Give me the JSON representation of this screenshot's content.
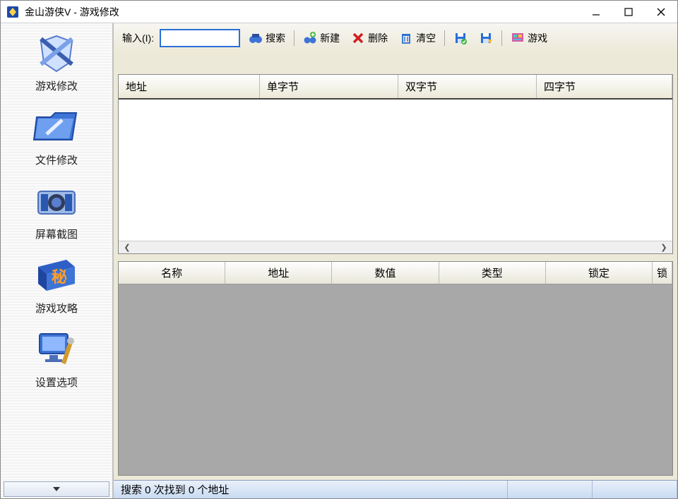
{
  "title": "金山游侠V - 游戏修改",
  "sidebar": {
    "items": [
      {
        "label": "游戏修改"
      },
      {
        "label": "文件修改"
      },
      {
        "label": "屏幕截图"
      },
      {
        "label": "游戏攻略"
      },
      {
        "label": "设置选项"
      }
    ]
  },
  "toolbar": {
    "input_label": "输入(I):",
    "input_value": "",
    "search": "搜索",
    "new": "新建",
    "delete": "删除",
    "clear": "清空",
    "game": "游戏"
  },
  "upper_table": {
    "columns": [
      "地址",
      "单字节",
      "双字节",
      "四字节"
    ]
  },
  "lower_table": {
    "columns": [
      "名称",
      "地址",
      "数值",
      "类型",
      "锁定",
      "锁"
    ]
  },
  "statusbar": {
    "text": "搜索 0 次找到 0 个地址"
  }
}
